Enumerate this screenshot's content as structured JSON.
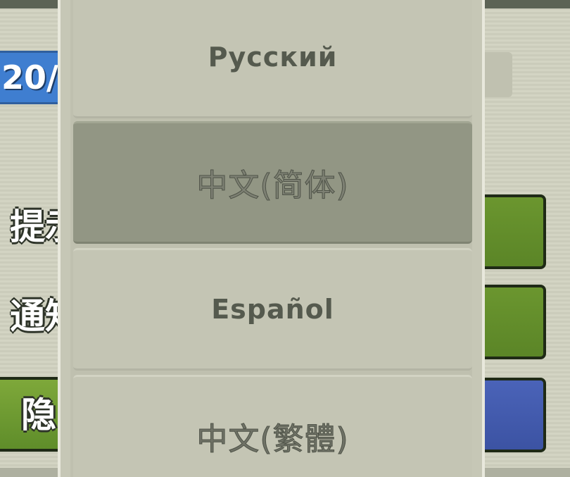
{
  "background": {
    "date_fragment": "20/",
    "labels": [
      "提示",
      "通知"
    ],
    "green_button_label": "隐",
    "colors": {
      "toggle_green": "#6b962f",
      "toggle_blue": "#4a63b8",
      "date_bar": "#3f7ed0"
    }
  },
  "language_dropdown": {
    "options": [
      {
        "label": "Русский",
        "selected": false
      },
      {
        "label": "中文(简体)",
        "selected": true
      },
      {
        "label": "Español",
        "selected": false
      },
      {
        "label": "中文(繁體)",
        "selected": false
      }
    ],
    "colors": {
      "option_bg": "#c4c5b4",
      "selected_bg": "#929684",
      "text": "#555a4e"
    }
  }
}
